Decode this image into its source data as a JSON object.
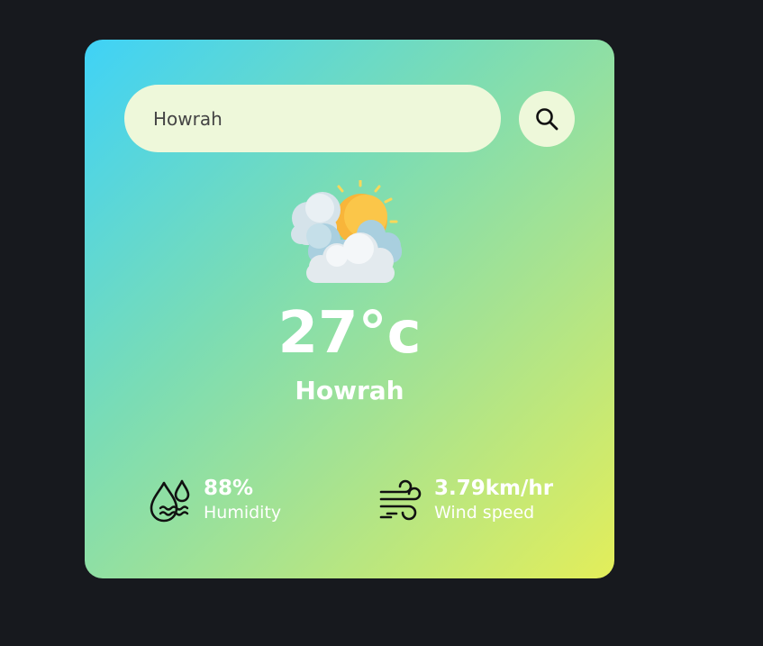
{
  "search": {
    "value": "Howrah",
    "button_icon": "search-icon"
  },
  "weather": {
    "icon": "partly-cloudy-icon",
    "temperature": "27°c",
    "city": "Howrah"
  },
  "details": {
    "humidity": {
      "icon": "humidity-icon",
      "value": "88%",
      "label": "Humidity"
    },
    "wind": {
      "icon": "wind-icon",
      "value": "3.79km/hr",
      "label": "Wind speed"
    }
  },
  "colors": {
    "background": "#17191e",
    "card_gradient_start": "#3fd2f7",
    "card_gradient_end": "#e3ee5a",
    "input_bg": "#eef8da",
    "text": "#ffffff"
  }
}
